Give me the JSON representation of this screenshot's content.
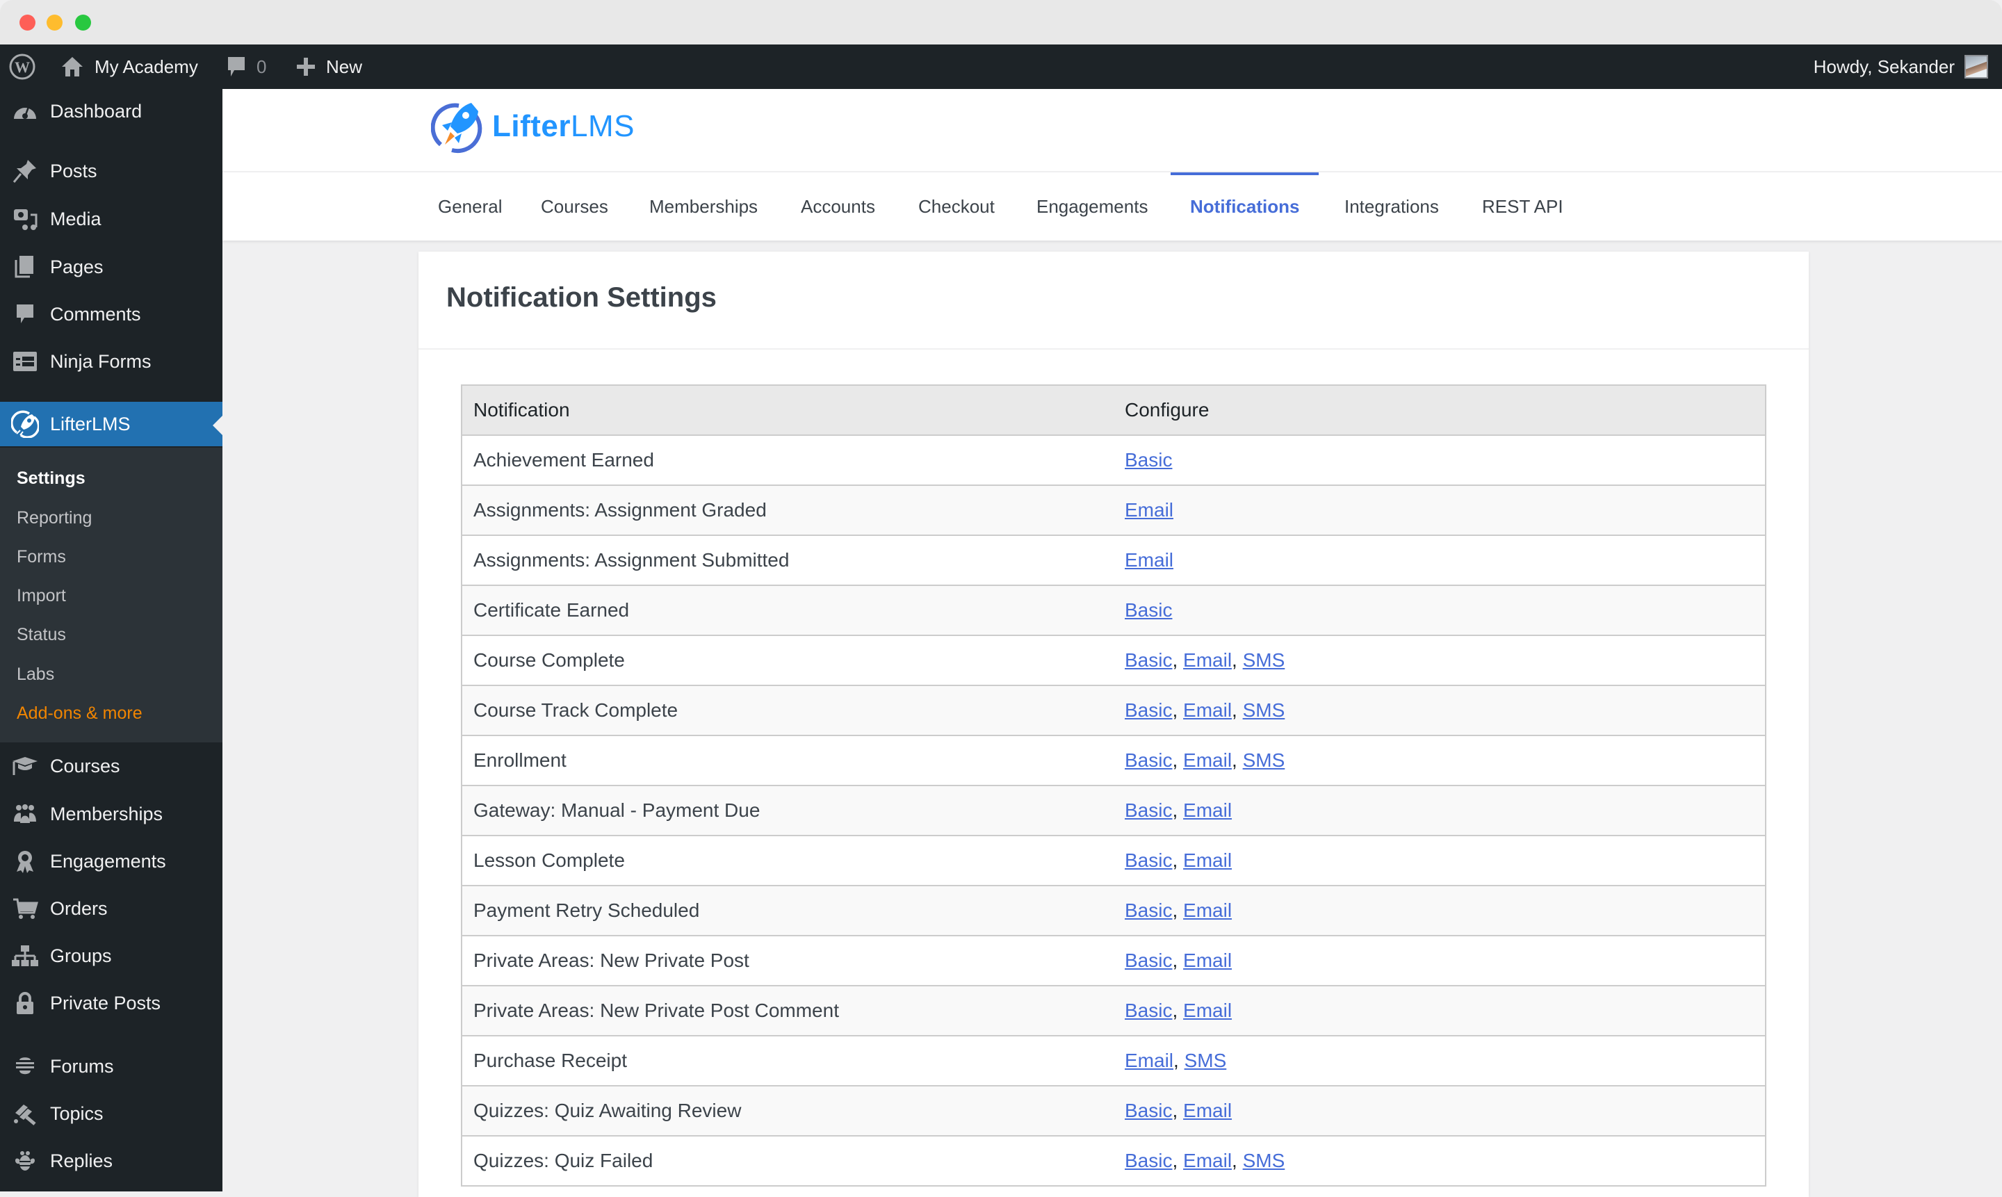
{
  "admin_bar": {
    "site_name": "My Academy",
    "comments_count": "0",
    "new_label": "New",
    "greeting": "Howdy, Sekander"
  },
  "sidebar": {
    "items_top": [
      {
        "label": "Dashboard",
        "icon": "dashboard-icon"
      },
      {
        "label": "Posts",
        "icon": "pin-icon"
      },
      {
        "label": "Media",
        "icon": "media-icon"
      },
      {
        "label": "Pages",
        "icon": "pages-icon"
      },
      {
        "label": "Comments",
        "icon": "comment-icon"
      },
      {
        "label": "Ninja Forms",
        "icon": "forms-icon"
      }
    ],
    "active_item": {
      "label": "LifterLMS",
      "icon": "rocket-icon"
    },
    "submenu": [
      {
        "label": "Settings",
        "current": true
      },
      {
        "label": "Reporting"
      },
      {
        "label": "Forms"
      },
      {
        "label": "Import"
      },
      {
        "label": "Status"
      },
      {
        "label": "Labs"
      },
      {
        "label": "Add-ons & more",
        "highlight": true
      }
    ],
    "items_bottom": [
      {
        "label": "Courses",
        "icon": "graduation-cap-icon"
      },
      {
        "label": "Memberships",
        "icon": "groups-icon"
      },
      {
        "label": "Engagements",
        "icon": "award-icon"
      },
      {
        "label": "Orders",
        "icon": "cart-icon"
      },
      {
        "label": "Groups",
        "icon": "hierarchy-icon"
      },
      {
        "label": "Private Posts",
        "icon": "lock-icon"
      },
      {
        "label": "Forums",
        "icon": "forums-icon"
      },
      {
        "label": "Topics",
        "icon": "topics-icon"
      },
      {
        "label": "Replies",
        "icon": "replies-icon"
      }
    ]
  },
  "brand": {
    "logo_text_bold": "Lifter",
    "logo_text_light": "LMS",
    "accent_color": "#466dd8"
  },
  "tabs": [
    {
      "label": "General"
    },
    {
      "label": "Courses"
    },
    {
      "label": "Memberships"
    },
    {
      "label": "Accounts"
    },
    {
      "label": "Checkout"
    },
    {
      "label": "Engagements"
    },
    {
      "label": "Notifications",
      "active": true
    },
    {
      "label": "Integrations"
    },
    {
      "label": "REST API"
    }
  ],
  "page": {
    "title": "Notification Settings",
    "table": {
      "headers": [
        "Notification",
        "Configure"
      ],
      "rows": [
        {
          "name": "Achievement Earned",
          "configure": [
            "Basic"
          ]
        },
        {
          "name": "Assignments: Assignment Graded",
          "configure": [
            "Email"
          ]
        },
        {
          "name": "Assignments: Assignment Submitted",
          "configure": [
            "Email"
          ]
        },
        {
          "name": "Certificate Earned",
          "configure": [
            "Basic"
          ]
        },
        {
          "name": "Course Complete",
          "configure": [
            "Basic",
            "Email",
            "SMS"
          ]
        },
        {
          "name": "Course Track Complete",
          "configure": [
            "Basic",
            "Email",
            "SMS"
          ]
        },
        {
          "name": "Enrollment",
          "configure": [
            "Basic",
            "Email",
            "SMS"
          ]
        },
        {
          "name": "Gateway: Manual - Payment Due",
          "configure": [
            "Basic",
            "Email"
          ]
        },
        {
          "name": "Lesson Complete",
          "configure": [
            "Basic",
            "Email"
          ]
        },
        {
          "name": "Payment Retry Scheduled",
          "configure": [
            "Basic",
            "Email"
          ]
        },
        {
          "name": "Private Areas: New Private Post",
          "configure": [
            "Basic",
            "Email"
          ]
        },
        {
          "name": "Private Areas: New Private Post Comment",
          "configure": [
            "Basic",
            "Email"
          ]
        },
        {
          "name": "Purchase Receipt",
          "configure": [
            "Email",
            "SMS"
          ]
        },
        {
          "name": "Quizzes: Quiz Awaiting Review",
          "configure": [
            "Basic",
            "Email"
          ]
        },
        {
          "name": "Quizzes: Quiz Failed",
          "configure": [
            "Basic",
            "Email",
            "SMS"
          ]
        }
      ]
    }
  }
}
